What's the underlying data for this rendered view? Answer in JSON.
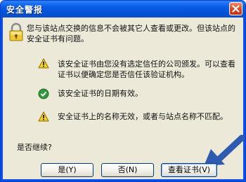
{
  "window": {
    "title": "安全警报"
  },
  "intro": {
    "text": "您与该站点交换的信息不会被其它人查看或更改。但该站点的安全证书有问题。"
  },
  "items": [
    {
      "icon": "warning-icon",
      "text": "该安全证书由您没有选定信任的公司颁发。可以查看证书以便确定您是否信任该验证机构。"
    },
    {
      "icon": "check-icon",
      "text": "该安全证书的日期有效。"
    },
    {
      "icon": "warning-icon",
      "text": "安全证书上的名称无效，或者与站点名称不匹配。"
    }
  ],
  "prompt": "是否继续?",
  "buttons": {
    "yes_label": "是(Y)",
    "no_label": "否(N)",
    "view_cert_label": "查看证书(V)"
  },
  "colors": {
    "titlebar": "#0a5de8",
    "client": "#ece9d8",
    "arrow": "#2e5ab0"
  }
}
